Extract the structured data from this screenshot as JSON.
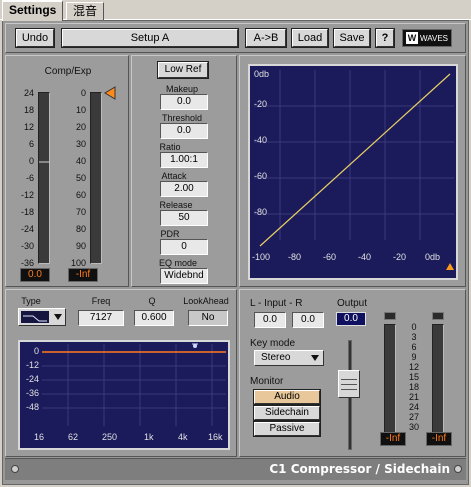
{
  "tabs": [
    {
      "label": "Settings"
    },
    {
      "label": "混音"
    }
  ],
  "toolbar": {
    "undo": "Undo",
    "setup": "Setup A",
    "ab": "A->B",
    "load": "Load",
    "save": "Save",
    "help": "?",
    "logo": "WAVES"
  },
  "compexp": {
    "title": "Comp/Exp",
    "scale_left": [
      "24",
      "18",
      "12",
      "6",
      "0",
      "-6",
      "-12",
      "-18",
      "-24",
      "-30",
      "-36"
    ],
    "scale_right": [
      "0",
      "10",
      "20",
      "30",
      "40",
      "50",
      "60",
      "70",
      "80",
      "90",
      "100"
    ],
    "value_left": "0.0",
    "value_right": "-Inf"
  },
  "params": {
    "low_ref": "Low Ref",
    "makeup_label": "Makeup",
    "makeup": "0.0",
    "threshold_label": "Threshold",
    "threshold": "0.0",
    "ratio_label": "Ratio",
    "ratio": "1.00:1",
    "attack_label": "Attack",
    "attack": "2.00",
    "release_label": "Release",
    "release": "50",
    "pdr_label": "PDR",
    "pdr": "0",
    "eqmode_label": "EQ mode",
    "eqmode": "Widebnd"
  },
  "transfer_graph": {
    "y_labels": [
      "0db",
      "-20",
      "-40",
      "-60",
      "-80"
    ],
    "x_labels": [
      "-100",
      "-80",
      "-60",
      "-40",
      "-20",
      "0db"
    ]
  },
  "eq": {
    "type_label": "Type",
    "freq_label": "Freq",
    "freq": "7127",
    "q_label": "Q",
    "q": "0.600",
    "lookahead_label": "LookAhead",
    "lookahead": "No",
    "y_labels": [
      "0",
      "-12",
      "-24",
      "-36",
      "-48"
    ],
    "x_labels": [
      "16",
      "62",
      "250",
      "1k",
      "4k",
      "16k"
    ]
  },
  "input": {
    "label": "L  - Input -  R",
    "left": "0.0",
    "right": "0.0",
    "output_label": "Output",
    "output": "0.0"
  },
  "keymode": {
    "label": "Key mode",
    "value": "Stereo"
  },
  "monitor": {
    "label": "Monitor",
    "audio": "Audio",
    "sidechain": "Sidechain",
    "passive": "Passive"
  },
  "output_meter": {
    "scale": [
      "0",
      "3",
      "6",
      "9",
      "12",
      "15",
      "18",
      "21",
      "24",
      "27",
      "30"
    ],
    "left": "-Inf",
    "right": "-Inf"
  },
  "status": {
    "title": "C1 Compressor / Sidechain"
  },
  "colors": {
    "graph_bg": "#1b1b5c",
    "curve": "#e8d060",
    "meter_readout": "#ff7a1a",
    "monitor_active": "#e8c89a"
  }
}
